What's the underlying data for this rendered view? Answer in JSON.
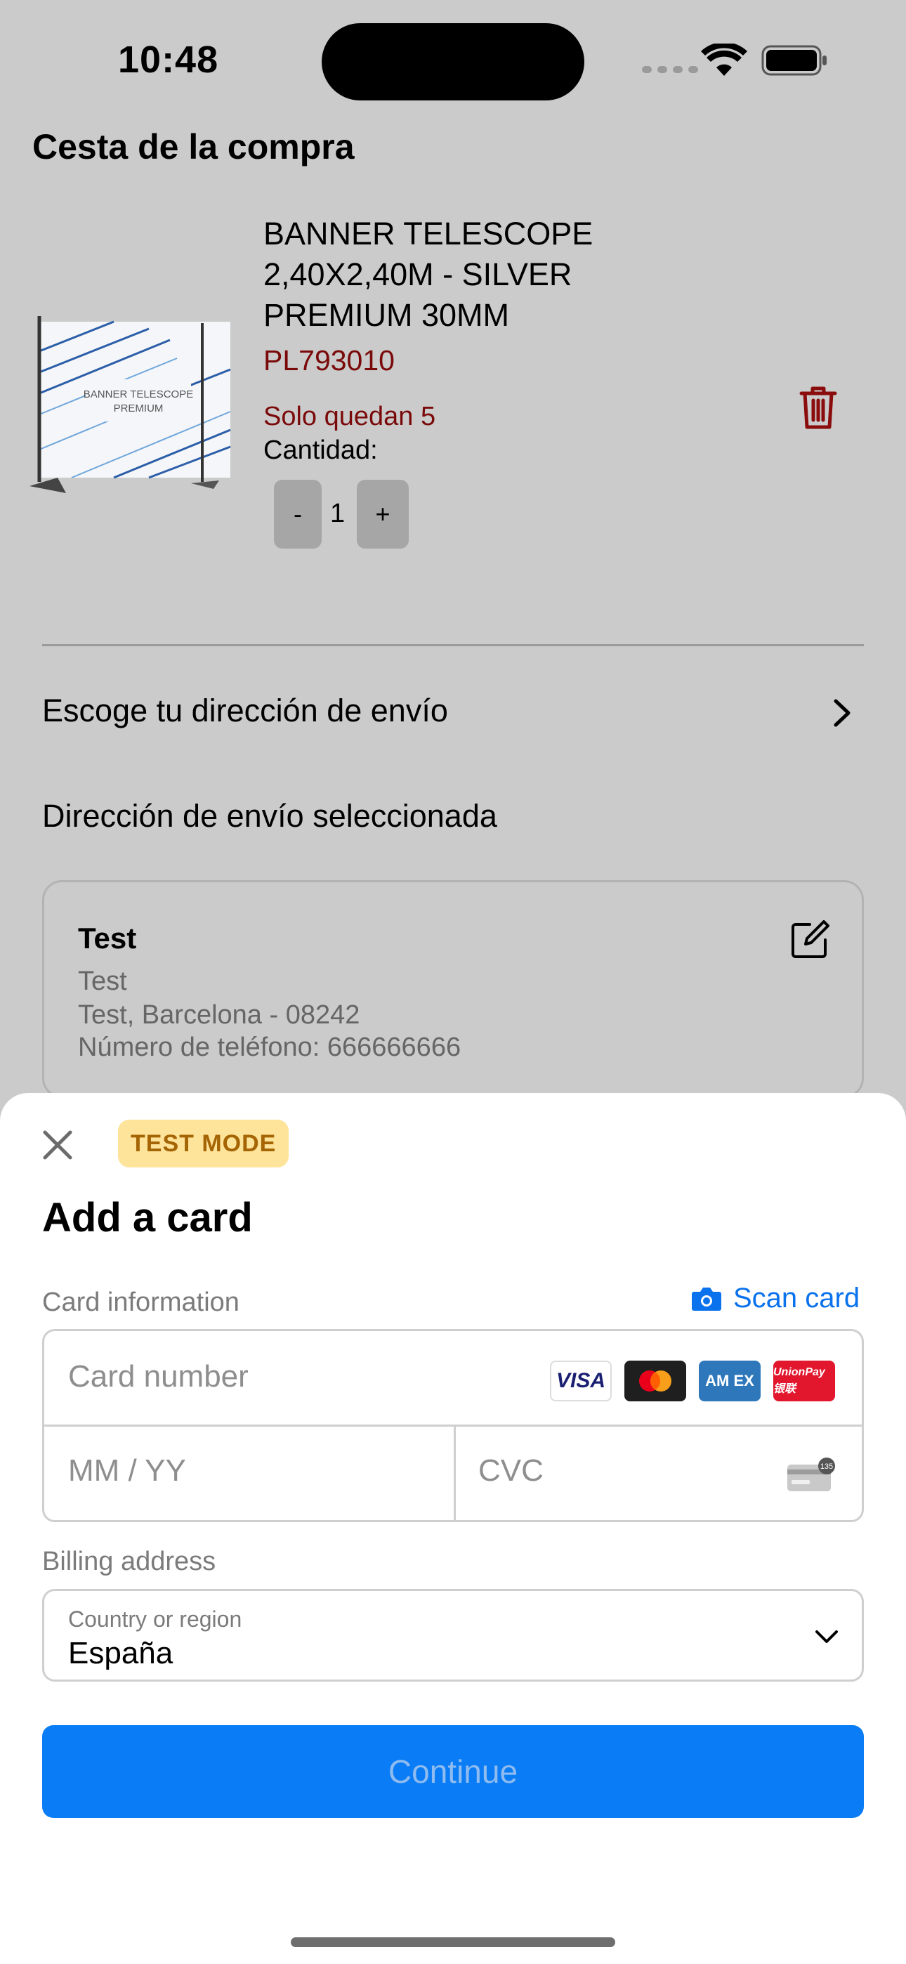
{
  "status_bar": {
    "time": "10:48"
  },
  "cart": {
    "title": "Cesta de la compra",
    "product": {
      "name": "BANNER TELESCOPE 2,40X2,40M - SILVER PREMIUM 30MM",
      "sku": "PL793010",
      "stock_note": "Solo quedan 5",
      "image_text_line1": "BANNER TELESCOPE",
      "image_text_line2": "PREMIUM",
      "quantity_label": "Cantidad:",
      "minus_label": "-",
      "quantity": "1",
      "plus_label": "+"
    }
  },
  "shipping": {
    "choose_label": "Escoge tu dirección de envío",
    "selected_title": "Dirección de envío seleccionada",
    "address": {
      "name": "Test",
      "line1": "Test",
      "line2": "Test, Barcelona - 08242",
      "phone": "Número de teléfono: 666666666"
    }
  },
  "payment_sheet": {
    "badge": "TEST MODE",
    "title": "Add a card",
    "card_info_label": "Card information",
    "scan_card_label": "Scan card",
    "card_number_placeholder": "Card number",
    "expiry_placeholder": "MM / YY",
    "cvc_placeholder": "CVC",
    "cvc_icon_number": "135",
    "brands": {
      "visa": "VISA",
      "amex": "AM EX",
      "unionpay": "UnionPay 银联"
    },
    "billing_label": "Billing address",
    "country_label": "Country or region",
    "country_value": "España",
    "continue_label": "Continue"
  },
  "colors": {
    "accent_blue": "#0a7cf5",
    "alert_red": "#7a0a0a",
    "badge_bg": "#fde49a",
    "badge_text": "#a56505",
    "backdrop": "#cbcbcb"
  }
}
